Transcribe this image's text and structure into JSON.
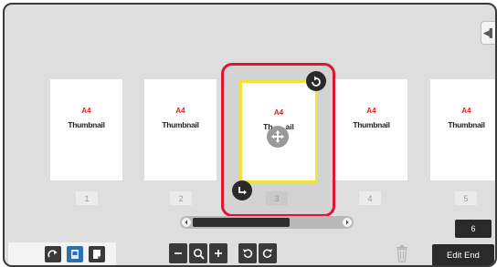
{
  "pages": [
    {
      "size": "A4",
      "label": "Thumbnail",
      "number": "1"
    },
    {
      "size": "A4",
      "label": "Thumbnail",
      "number": "2"
    },
    {
      "size": "A4",
      "label": "Th",
      "label_tail": "ail",
      "number": "3"
    },
    {
      "size": "A4",
      "label": "Thumbnail",
      "number": "4"
    },
    {
      "size": "A4",
      "label": "Thumbnail",
      "number": "5"
    }
  ],
  "page_count": "6",
  "edit_end_label": "Edit End",
  "icons": {
    "side_tab": "panel-collapse-icon",
    "move": "move-arrows-icon",
    "rotate_top": "rotate-icon",
    "rotate_bottom": "rotate-icon",
    "scroll_left": "chevron-left-icon",
    "scroll_right": "chevron-right-icon",
    "zoom_out": "minus-icon",
    "zoom": "magnifier-icon",
    "zoom_in": "plus-icon",
    "rotate_left": "rotate-left-icon",
    "rotate_right": "rotate-right-icon",
    "trash": "trash-icon"
  },
  "colors": {
    "selection": "#e0152f",
    "highlight": "#f2e23a",
    "size_text": "#d9231c"
  }
}
